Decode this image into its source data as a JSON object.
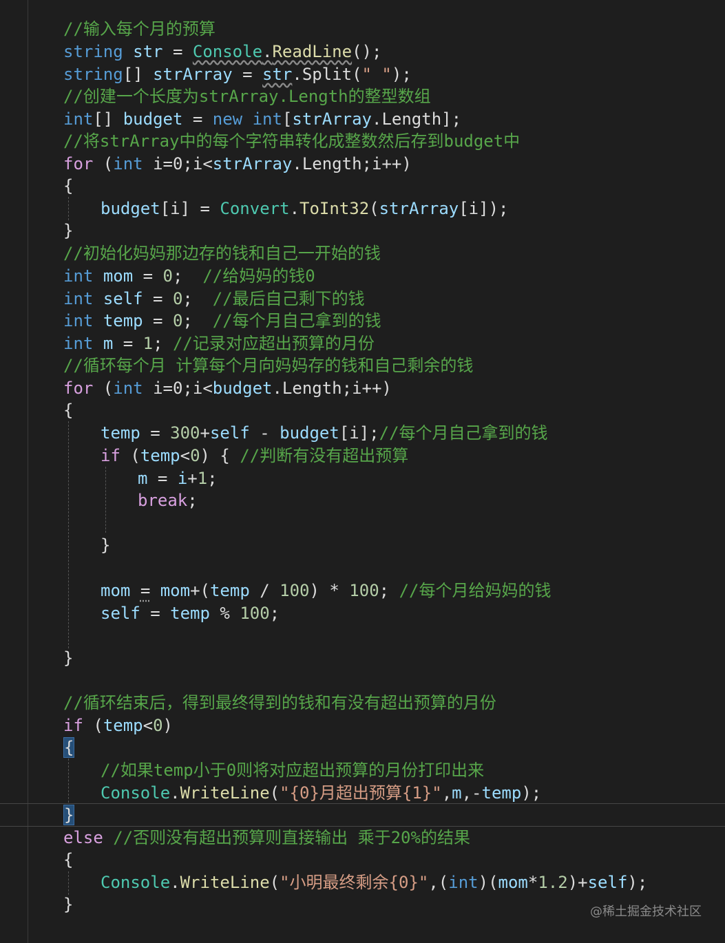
{
  "editor": {
    "lines": {
      "l1": {
        "c": "//输入每个月的预算"
      },
      "l2": {
        "a": "string",
        "b": " ",
        "c": "str",
        "d": " = ",
        "e": "Console",
        "f": ".",
        "g": "ReadLine",
        "h": "();"
      },
      "l3": {
        "a": "string",
        "b": "[] ",
        "c": "strArray",
        "d": " = ",
        "e": "str",
        "f": ".Split(",
        "g": "\" \"",
        "h": ");"
      },
      "l4": {
        "c": "//创建一个长度为strArray.Length的整型数组"
      },
      "l5": {
        "a": "int",
        "b": "[] ",
        "c": "budget",
        "d": " = ",
        "e": "new",
        "f": " ",
        "g": "int",
        "h": "[",
        "i": "strArray",
        "j": ".Length];"
      },
      "l6": {
        "c": "//将strArray中的每个字符串转化成整数然后存到budget中"
      },
      "l7": {
        "a": "for",
        "b": " (",
        "c": "int",
        "d": " i=0;i<",
        "e": "strArray",
        "f": ".Length;i++)"
      },
      "l8": {
        "a": "{"
      },
      "l9": {
        "a": "budget",
        "b": "[i] = ",
        "c": "Convert",
        "d": ".",
        "e": "ToInt32",
        "f": "(",
        "g": "strArray",
        "h": "[i]);"
      },
      "l10": {
        "a": "}"
      },
      "l11": {
        "c": "//初始化妈妈那边存的钱和自己一开始的钱"
      },
      "l12": {
        "a": "int",
        "b": " ",
        "c": "mom",
        "d": " = ",
        "e": "0",
        "f": ";  ",
        "g": "//给妈妈的钱0"
      },
      "l13": {
        "a": "int",
        "b": " ",
        "c": "self",
        "d": " = ",
        "e": "0",
        "f": ";  ",
        "g": "//最后自己剩下的钱"
      },
      "l14": {
        "a": "int",
        "b": " ",
        "c": "temp",
        "d": " = ",
        "e": "0",
        "f": ";  ",
        "g": "//每个月自己拿到的钱"
      },
      "l15": {
        "a": "int",
        "b": " ",
        "c": "m",
        "d": " = ",
        "e": "1",
        "f": "; ",
        "g": "//记录对应超出预算的月份"
      },
      "l16": {
        "c": "//循环每个月 计算每个月向妈妈存的钱和自己剩余的钱"
      },
      "l17": {
        "a": "for",
        "b": " (",
        "c": "int",
        "d": " i=0;i<",
        "e": "budget",
        "f": ".Length;i++)"
      },
      "l18": {
        "a": "{"
      },
      "l19": {
        "a": "temp",
        "b": " = ",
        "c": "300",
        "d": "+",
        "e": "self",
        "f": " - ",
        "g": "budget",
        "h": "[i];",
        "i": "//每个月自己拿到的钱"
      },
      "l20": {
        "a": "if",
        "b": " (",
        "c": "temp",
        "d": "<",
        "e": "0",
        "f": ") { ",
        "g": "//判断有没有超出预算"
      },
      "l21": {
        "a": "m",
        "b": " = ",
        "c": "i",
        "d": "+",
        "e": "1",
        "f": ";"
      },
      "l22": {
        "a": "break",
        "b": ";"
      },
      "l23": {
        "a": "}"
      },
      "l24": {
        "a": "mom",
        "b": " ",
        "c": "=",
        "d": " ",
        "e": "mom",
        "f": "+(",
        "g": "temp",
        "h": " / ",
        "i": "100",
        "j": ") * ",
        "k": "100",
        "l": "; ",
        "m": "//每个月给妈妈的钱"
      },
      "l25": {
        "a": "self",
        "b": " = ",
        "c": "temp",
        "d": " % ",
        "e": "100",
        "f": ";"
      },
      "l26": {
        "a": "}"
      },
      "l27": {
        "c": "//循环结束后，得到最终得到的钱和有没有超出预算的月份"
      },
      "l28": {
        "a": "if",
        "b": " (",
        "c": "temp",
        "d": "<",
        "e": "0",
        "f": ")"
      },
      "l29": {
        "a": "{"
      },
      "l30": {
        "c": "//如果temp小于0则将对应超出预算的月份打印出来"
      },
      "l31": {
        "a": "Console",
        "b": ".",
        "c": "WriteLine",
        "d": "(",
        "e": "\"{0}月超出预算{1}\"",
        "f": ",",
        "g": "m",
        "h": ",-",
        "i": "temp",
        "j": ");"
      },
      "l32": {
        "a": "}"
      },
      "l33": {
        "a": "else",
        "b": " ",
        "c": "//否则没有超出预算则直接输出 乘于20%的结果"
      },
      "l34": {
        "a": "{"
      },
      "l35": {
        "a": "Console",
        "b": ".",
        "c": "WriteLine",
        "d": "(",
        "e": "\"小明最终剩余{0}\"",
        "f": ",(",
        "g": "int",
        "h": ")(",
        "i": "mom",
        "j": "*",
        "k": "1.2",
        "l": ")+",
        "m": "self",
        "n": ");"
      },
      "l36": {
        "a": "}"
      }
    }
  },
  "watermark": "@稀土掘金技术社区",
  "colors": {
    "background": "#1e1e1e",
    "keyword": "#569cd6",
    "control": "#d8a0df",
    "comment": "#57a64a",
    "type": "#4ec9b0",
    "variable": "#9cdcfe",
    "number": "#b5cea8",
    "string": "#d69d85",
    "method": "#dcdcaa"
  }
}
